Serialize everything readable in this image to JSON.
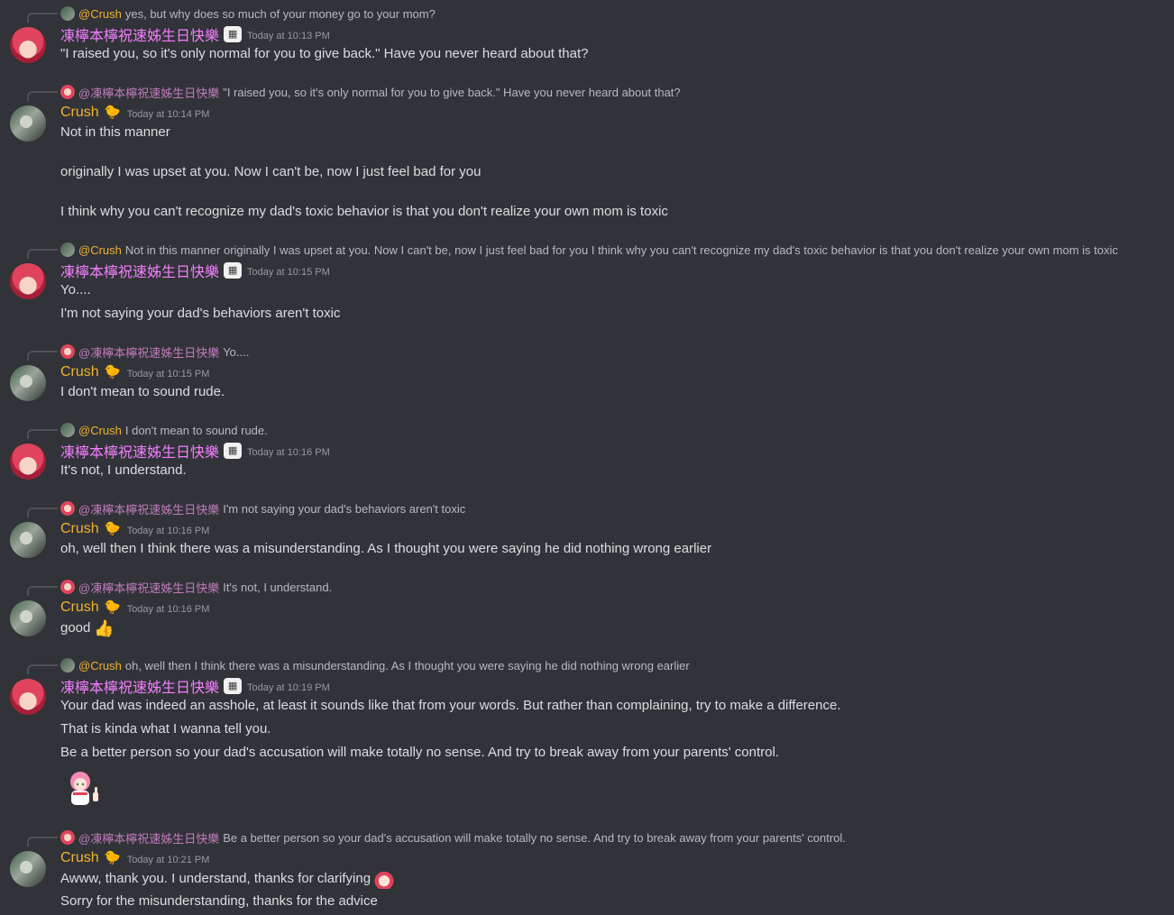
{
  "users": {
    "crush": {
      "name": "Crush",
      "mention": "@Crush",
      "color": "#f0b232",
      "badge_icon": "chick-icon"
    },
    "other": {
      "name": "凍檸本檸祝速姊生日快樂",
      "mention": "@凍檸本檸祝速姊生日快樂",
      "color": "#f47fff",
      "badge_icon": "cake-icon"
    }
  },
  "messages": [
    {
      "reply_to": "@Crush",
      "reply_text": "yes, but why does so much of your money go to your mom?",
      "author": "凍檸本檸祝速姊生日快樂",
      "timestamp": "Today at 10:13 PM",
      "lines": [
        "\"I raised you, so it's only normal for you to give back.\" Have you never heard about that?"
      ]
    },
    {
      "reply_to": "@凍檸本檸祝速姊生日快樂",
      "reply_text": "\"I raised you, so it's only normal for you to give back.\" Have you never heard about that?",
      "author": "Crush",
      "timestamp": "Today at 10:14 PM",
      "lines": [
        "Not in this manner",
        "originally I was upset at you. Now I can't be, now I just feel bad for you",
        "I think why you can't recognize my dad's toxic behavior is that you don't realize your own mom is toxic"
      ]
    },
    {
      "reply_to": "@Crush",
      "reply_text": "Not in this manner  originally I was upset at you. Now I can't be, now I just feel bad for you  I think why you can't recognize my dad's toxic behavior is that you don't realize your own mom is toxic",
      "author": "凍檸本檸祝速姊生日快樂",
      "timestamp": "Today at 10:15 PM",
      "lines": [
        "Yo....",
        "I'm not saying your dad's behaviors aren't toxic"
      ]
    },
    {
      "reply_to": "@凍檸本檸祝速姊生日快樂",
      "reply_text": "Yo....",
      "author": "Crush",
      "timestamp": "Today at 10:15 PM",
      "lines": [
        "I don't mean to sound rude."
      ]
    },
    {
      "reply_to": "@Crush",
      "reply_text": "I don't mean to sound rude.",
      "author": "凍檸本檸祝速姊生日快樂",
      "timestamp": "Today at 10:16 PM",
      "lines": [
        "It's not, I understand."
      ]
    },
    {
      "reply_to": "@凍檸本檸祝速姊生日快樂",
      "reply_text": "I'm not saying your dad's behaviors aren't toxic",
      "author": "Crush",
      "timestamp": "Today at 10:16 PM",
      "lines": [
        "oh, well then I think there was a misunderstanding. As I thought you were saying he did nothing wrong earlier"
      ]
    },
    {
      "reply_to": "@凍檸本檸祝速姊生日快樂",
      "reply_text": "It's not, I understand.",
      "author": "Crush",
      "timestamp": "Today at 10:16 PM",
      "lines": [
        "good"
      ],
      "line_emoji": "thumbs-up-icon"
    },
    {
      "reply_to": "@Crush",
      "reply_text": "oh, well then I think there was a misunderstanding. As I thought you were saying he did nothing wrong earlier",
      "author": "凍檸本檸祝速姊生日快樂",
      "timestamp": "Today at 10:19 PM",
      "lines": [
        "Your dad was indeed an asshole, at least it sounds like that from your words. But rather than complaining, try to make a difference.",
        "That is kinda what I wanna tell you.",
        "Be a better person so your dad's accusation will make totally no sense. And try to break away from your parents' control."
      ],
      "sticker": "anime-girl-thumbs-up-sticker"
    },
    {
      "reply_to": "@凍檸本檸祝速姊生日快樂",
      "reply_text": "Be a better person so your dad's accusation will make totally no sense. And try to break away from your parents' control.",
      "author": "Crush",
      "timestamp": "Today at 10:21 PM",
      "lines": [
        "Awww, thank you. I understand, thanks for clarifying",
        "Sorry for the misunderstanding, thanks for the advice"
      ],
      "line_emoji": "anime-face-emoji"
    }
  ]
}
